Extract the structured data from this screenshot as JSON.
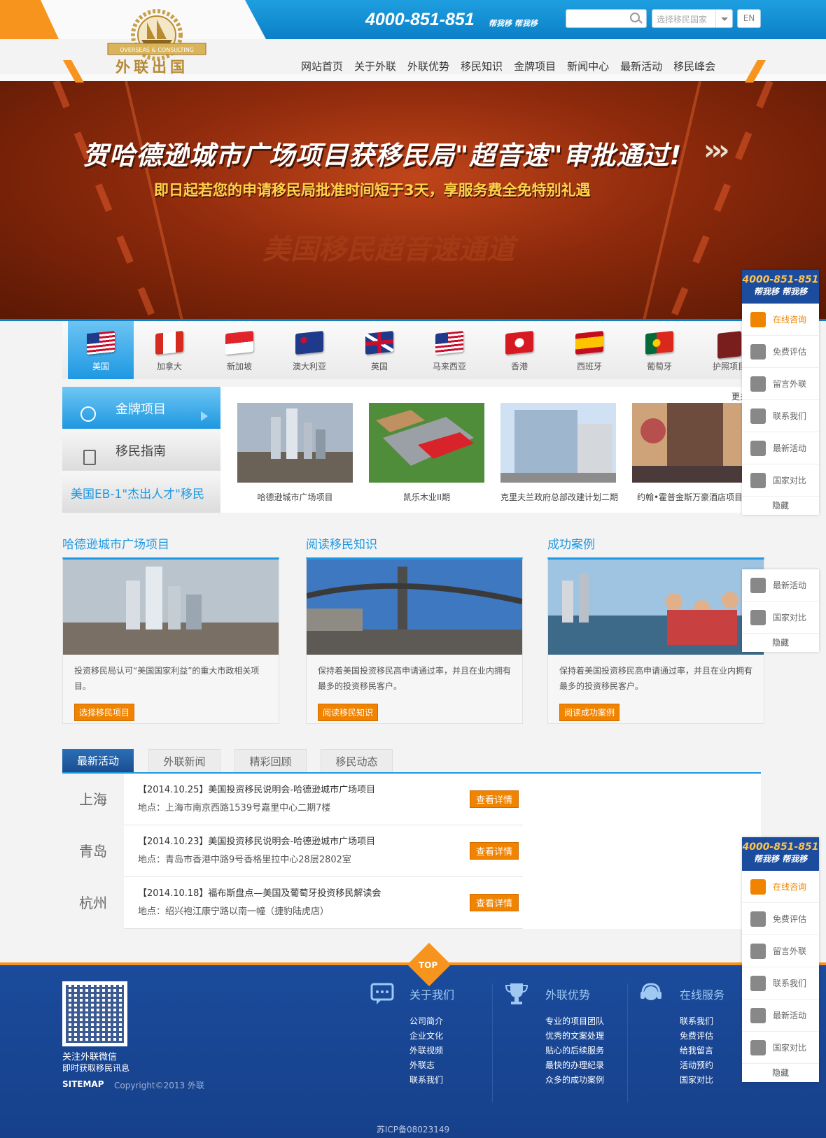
{
  "header": {
    "hotline": "4000-851-851",
    "hotline_slogan": "帮我移 帮我移",
    "search_placeholder": "",
    "country_select_placeholder": "选择移民国家",
    "lang_button": "EN",
    "logo_caption": "外联出国",
    "logo_ribbon": "OVERSEAS & CONSULTING"
  },
  "nav": [
    "网站首页",
    "关于外联",
    "外联优势",
    "移民知识",
    "金牌项目",
    "新闻中心",
    "最新活动",
    "移民峰会"
  ],
  "banner": {
    "title": "贺哈德逊城市广场项目获移民局\"超音速\"审批通过!",
    "subtitle": "即日起若您的申请移民局批准时间短于3天，享服务费全免特别礼遇",
    "ghost_text": "美国移民超音速通道"
  },
  "flags": [
    {
      "label": "美国",
      "active": true
    },
    {
      "label": "加拿大"
    },
    {
      "label": "新加坡"
    },
    {
      "label": "澳大利亚"
    },
    {
      "label": "英国"
    },
    {
      "label": "马来西亚"
    },
    {
      "label": "香港"
    },
    {
      "label": "西班牙"
    },
    {
      "label": "葡萄牙"
    },
    {
      "label": "护照项目"
    }
  ],
  "side_tabs": {
    "gold": "金牌项目",
    "guide": "移民指南",
    "eb1": "美国EB-1\"杰出人才\"移民"
  },
  "more_link": "更多",
  "projects": [
    {
      "caption": "哈德逊城市广场项目"
    },
    {
      "caption": "凯乐木业II期"
    },
    {
      "caption": "克里夫兰政府总部改建计划二期"
    },
    {
      "caption": "约翰•霍普金斯万豪酒店项目"
    }
  ],
  "columns": [
    {
      "title": "哈德逊城市广场项目",
      "text": "投资移民局认可“美国国家利益”的重大市政相关项目。",
      "button": "选择移民项目"
    },
    {
      "title": "阅读移民知识",
      "text": "保持着美国投资移民高申请通过率，并且在业内拥有最多的投资移民客户。",
      "button": "阅读移民知识"
    },
    {
      "title": "成功案例",
      "text": "保持着美国投资移民高申请通过率，并且在业内拥有最多的投资移民客户。",
      "button": "阅读成功案例"
    }
  ],
  "activity_tabs": [
    "最新活动",
    "外联新闻",
    "精彩回顾",
    "移民动态"
  ],
  "activities": [
    {
      "city": "上海",
      "title": "【2014.10.25】美国投资移民说明会-哈德逊城市广场项目",
      "address": "地点：上海市南京西路1539号嘉里中心二期7楼",
      "button": "查看详情"
    },
    {
      "city": "青岛",
      "title": "【2014.10.23】美国投资移民说明会-哈德逊城市广场项目",
      "address": "地点：青岛市香港中路9号香格里拉中心28层2802室",
      "button": "查看详情"
    },
    {
      "city": "杭州",
      "title": "【2014.10.18】福布斯盘点—美国及葡萄牙投资移民解读会",
      "address": "地点：绍兴袍江康宁路以南一幢（捷豹陆虎店）",
      "button": "查看详情"
    }
  ],
  "footer": {
    "top_label": "TOP",
    "wechat_title": "关注外联微信",
    "wechat_sub": "即时获取移民讯息",
    "sitemap": "SITEMAP",
    "copyright": "Copyright©2013 外联",
    "icp": "苏ICP备08023149",
    "cols": [
      {
        "title": "关于我们",
        "links": [
          "公司简介",
          "企业文化",
          "外联视频",
          "外联志",
          "联系我们"
        ]
      },
      {
        "title": "外联优势",
        "links": [
          "专业的项目团队",
          "优秀的文案处理",
          "贴心的后续服务",
          "最快的办理纪录",
          "众多的成功案例"
        ]
      },
      {
        "title": "在线服务",
        "links": [
          "联系我们",
          "免费评估",
          "给我留言",
          "活动预约",
          "国家对比"
        ]
      }
    ]
  },
  "widget": {
    "phone": "4000-851-851",
    "slogan": "帮我移 帮我移",
    "items": [
      "在线咨询",
      "免费评估",
      "留言外联",
      "联系我们",
      "最新活动",
      "国家对比"
    ],
    "mini_items": [
      "最新活动",
      "国家对比"
    ],
    "hide": "隐藏"
  },
  "colors": {
    "brand_blue": "#1e98e2",
    "accent_orange": "#f08300",
    "footer_blue": "#1b4b9c",
    "banner_red": "#8e2a0c"
  }
}
